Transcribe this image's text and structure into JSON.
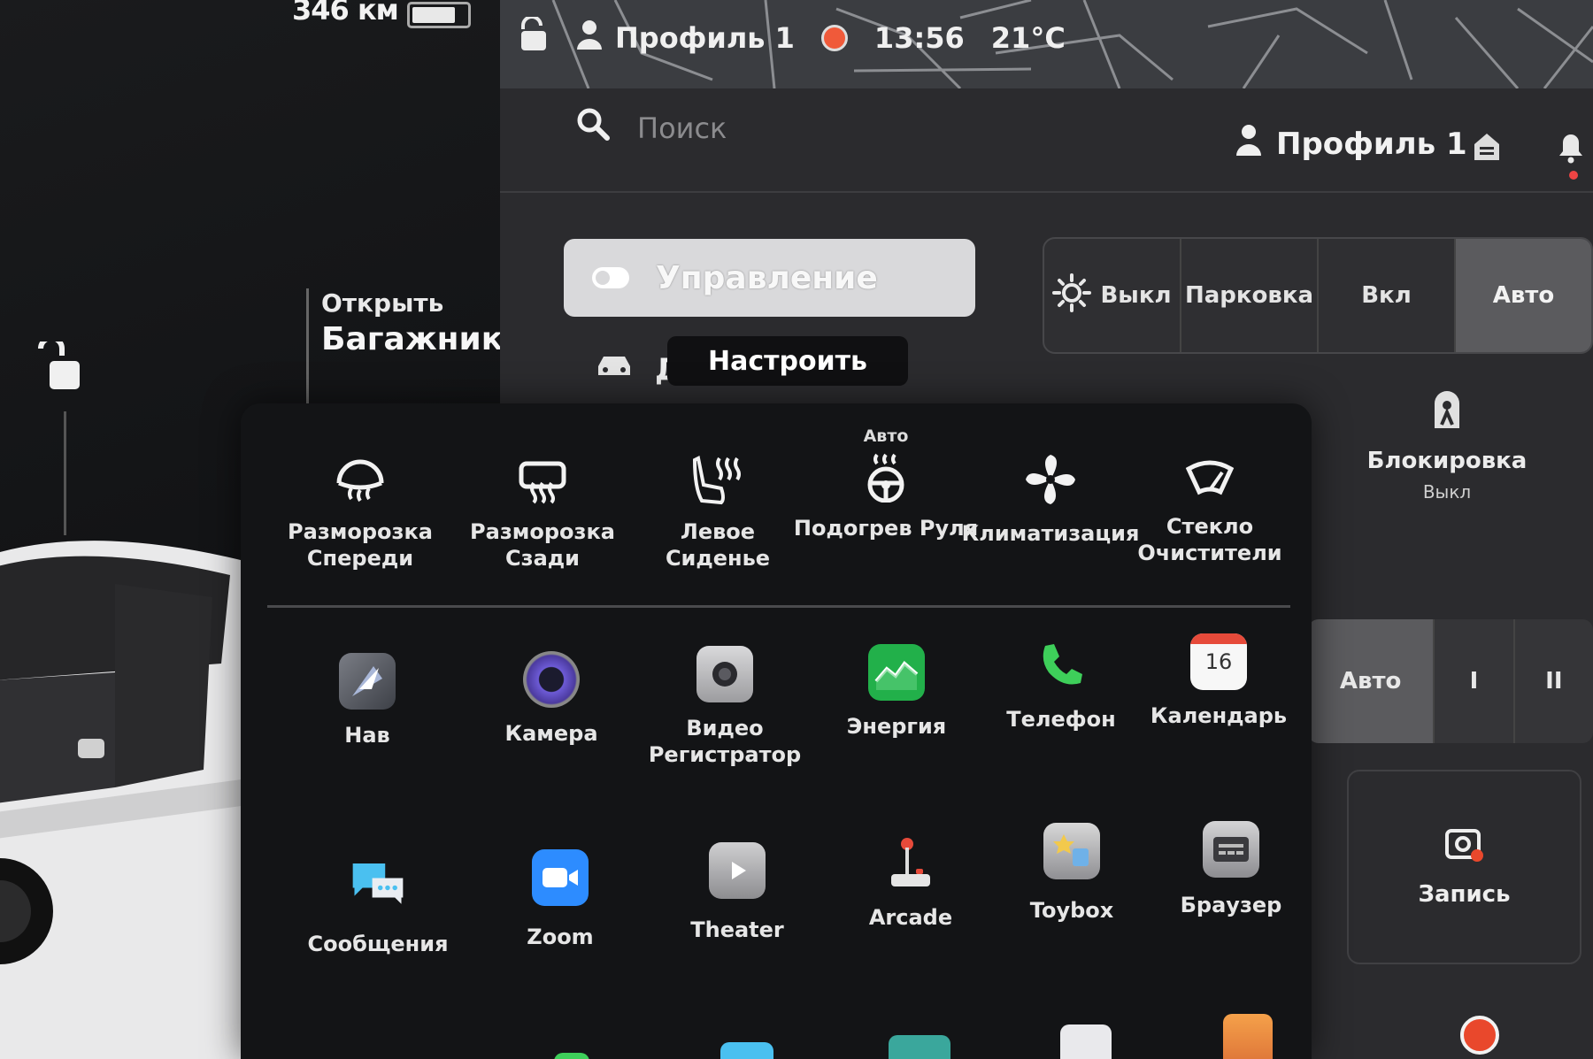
{
  "status": {
    "range": "346 км",
    "battery_level": 0.8,
    "profile": "Профиль 1",
    "time": "13:56",
    "temperature": "21°C"
  },
  "left": {
    "trunk_open": "Открыть",
    "trunk_name": "Багажник"
  },
  "header": {
    "search_placeholder": "Поиск",
    "profile": "Профиль 1"
  },
  "controls": {
    "title": "Управление",
    "car_row_partial": "Д",
    "tooltip": "Настроить",
    "lights": [
      "Выкл",
      "Парковка",
      "Вкл",
      "Авто"
    ],
    "lights_active": "Авто",
    "lock_label": "Блокировка",
    "lock_state": "Выкл",
    "wipers": [
      "Авто",
      "I",
      "II"
    ],
    "record": "Запись"
  },
  "quick_controls": [
    {
      "icon": "front-defrost-icon",
      "label": "Разморозка Спереди"
    },
    {
      "icon": "rear-defrost-icon",
      "label": "Разморозка Сзади"
    },
    {
      "icon": "seat-heater-icon",
      "label": "Левое Сиденье"
    },
    {
      "icon": "steering-heater-icon",
      "label": "Подогрев Руля",
      "badge": "Авто"
    },
    {
      "icon": "fan-icon",
      "label": "Климатизация"
    },
    {
      "icon": "wiper-icon",
      "label": "Стекло Очистители"
    }
  ],
  "apps": [
    {
      "icon": "nav-icon",
      "label": "Нав"
    },
    {
      "icon": "camera-icon",
      "label": "Камера"
    },
    {
      "icon": "dashcam-icon",
      "label": "Видео Регистратор"
    },
    {
      "icon": "energy-icon",
      "label": "Энергия"
    },
    {
      "icon": "phone-icon",
      "label": "Телефон"
    },
    {
      "icon": "calendar-icon",
      "label": "Календарь",
      "day": "16"
    },
    {
      "icon": "messages-icon",
      "label": "Сообщения"
    },
    {
      "icon": "zoom-icon",
      "label": "Zoom"
    },
    {
      "icon": "theater-icon",
      "label": "Theater"
    },
    {
      "icon": "arcade-icon",
      "label": "Arcade"
    },
    {
      "icon": "toybox-icon",
      "label": "Toybox"
    },
    {
      "icon": "browser-icon",
      "label": "Браузер"
    }
  ],
  "colors": {
    "accent_record": "#e9482c",
    "energy_green": "#22b04a",
    "phone_green": "#3ecf5a",
    "zoom_blue": "#2d8cff"
  }
}
